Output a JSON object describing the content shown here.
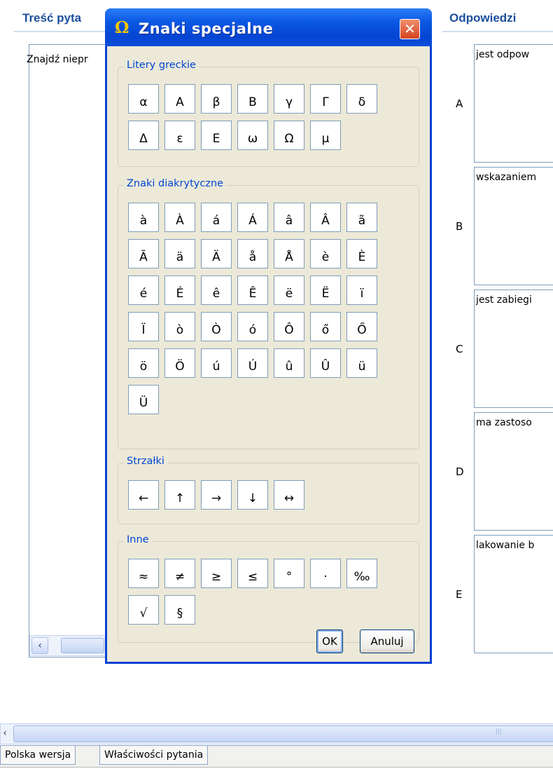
{
  "window": {
    "question_header": "Treść pyta",
    "answers_header": "Odpowiedzi",
    "question_text": "Znajdź niepr",
    "answers": [
      {
        "letter": "A",
        "text": "jest odpow"
      },
      {
        "letter": "B",
        "text": "wskazaniem"
      },
      {
        "letter": "C",
        "text": "jest zabiegi"
      },
      {
        "letter": "D",
        "text": "ma zastoso"
      },
      {
        "letter": "E",
        "text": "lakowanie b"
      }
    ],
    "tabs": [
      "Polska wersja",
      "Właściwości pytania"
    ]
  },
  "dialog": {
    "title": "Znaki specjalne",
    "icon": "omega-icon",
    "close_label": "✕",
    "groups": [
      {
        "label": "Litery greckie",
        "chars": [
          "α",
          "Α",
          "β",
          "Β",
          "γ",
          "Γ",
          "δ",
          "Δ",
          "ε",
          "Ε",
          "ω",
          "Ω",
          "μ"
        ]
      },
      {
        "label": "Znaki diakrytyczne",
        "chars": [
          "à",
          "À",
          "á",
          "Á",
          "â",
          "Â",
          "ã",
          "Ã",
          "ä",
          "Ä",
          "å",
          "Å",
          "è",
          "È",
          "é",
          "É",
          "ê",
          "Ê",
          "ë",
          "Ë",
          "ï",
          "Ï",
          "ò",
          "Ò",
          "ó",
          "Ô",
          "ő",
          "Ő",
          "ö",
          "Ö",
          "ú",
          "Ú",
          "û",
          "Û",
          "ü",
          "Ü"
        ]
      },
      {
        "label": "Strzałki",
        "chars": [
          "←",
          "↑",
          "→",
          "↓",
          "↔"
        ]
      },
      {
        "label": "Inne",
        "chars": [
          "≈",
          "≠",
          "≥",
          "≤",
          "°",
          "·",
          "‰",
          "√",
          "§"
        ]
      }
    ],
    "ok_label": "OK",
    "cancel_label": "Anuluj"
  },
  "icons": {
    "scroll_left": "◀",
    "scroll_grip": "|||"
  }
}
